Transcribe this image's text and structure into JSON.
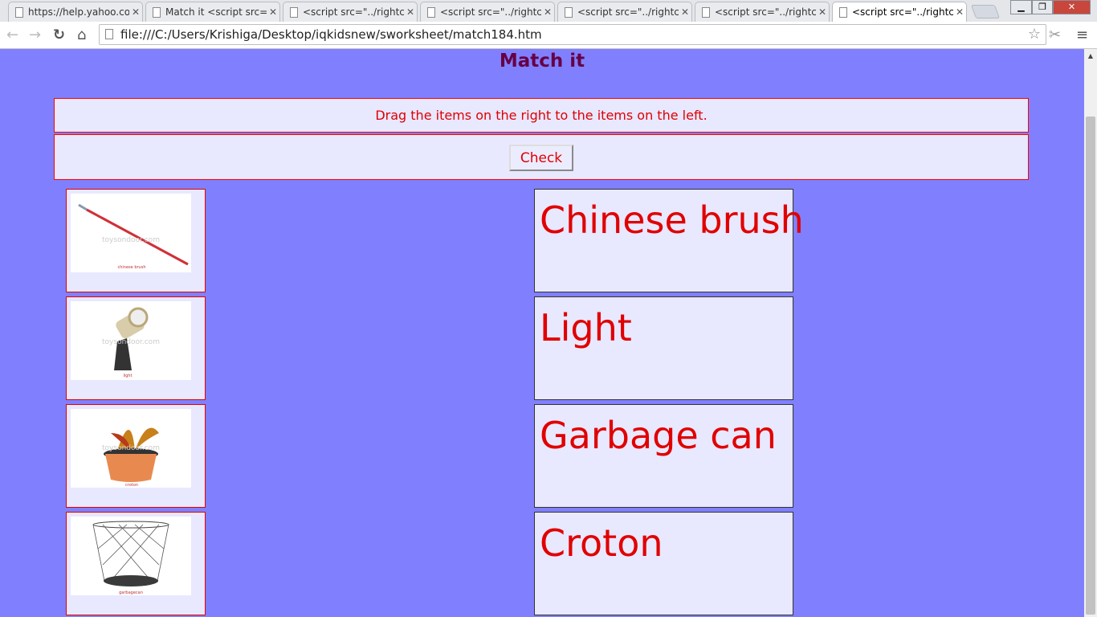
{
  "browser": {
    "tabs": [
      {
        "label": "https://help.yahoo.co"
      },
      {
        "label": "Match it <script src=\""
      },
      {
        "label": "<script src=\"../rightcli"
      },
      {
        "label": "<script src=\"../rightcli"
      },
      {
        "label": "<script src=\"../rightcli"
      },
      {
        "label": "<script src=\"../rightcli"
      },
      {
        "label": "<script src=\"../rightcli"
      }
    ],
    "url": "file:///C:/Users/Krishiga/Desktop/iqkidsnew/sworksheet/match184.htm"
  },
  "page": {
    "title": "Match it",
    "instruction": "Drag the items on the right to the items on the left.",
    "check_label": "Check",
    "left_items": [
      {
        "caption": "chinese brush",
        "watermark": "toysondoor.com"
      },
      {
        "caption": "light",
        "watermark": "toysondoor.com"
      },
      {
        "caption": "croton",
        "watermark": "toysondoor.com"
      },
      {
        "caption": "garbagecan",
        "watermark": "toysondoor.com"
      }
    ],
    "right_items": [
      "Chinese brush",
      "Light",
      "Garbage can",
      "Croton"
    ]
  },
  "colors": {
    "page_bg": "#8080ff",
    "cell_bg": "#e8e8ff",
    "text_red": "#e00000",
    "title": "#660044"
  }
}
